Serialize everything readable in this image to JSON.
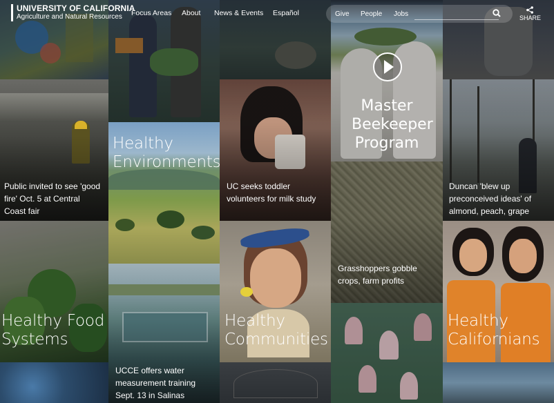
{
  "header": {
    "logo_line1": "UNIVERSITY OF CALIFORNIA",
    "logo_line2": "Agriculture and Natural Resources",
    "nav": [
      "Focus Areas",
      "About",
      "News & Events",
      "Español"
    ],
    "utility_links": [
      "Give",
      "People",
      "Jobs"
    ],
    "search_icon": "search-icon",
    "share_label": "SHARE",
    "share_icon": "share-icon"
  },
  "tiles": {
    "good_fire": "Public invited to see 'good fire' Oct. 5 at Central Coast fair",
    "healthy_environments": "Healthy Environments",
    "toddler_study": "UC seeks toddler volunteers for milk study",
    "master_beekeeper": "Master Beekeeper Program",
    "duncan": "Duncan 'blew up preconceived ideas' of almond, peach, grape",
    "grasshoppers": "Grasshoppers gobble crops, farm profits",
    "healthy_food": "Healthy Food Systems",
    "healthy_communities": "Healthy Communities",
    "healthy_californians": "Healthy Californians",
    "ucce_water": "UCCE offers water measurement training Sept. 13 in Salinas",
    "play_icon": "play-icon"
  },
  "colors": {
    "brand": "#1e3a5f",
    "text": "#ffffff"
  }
}
